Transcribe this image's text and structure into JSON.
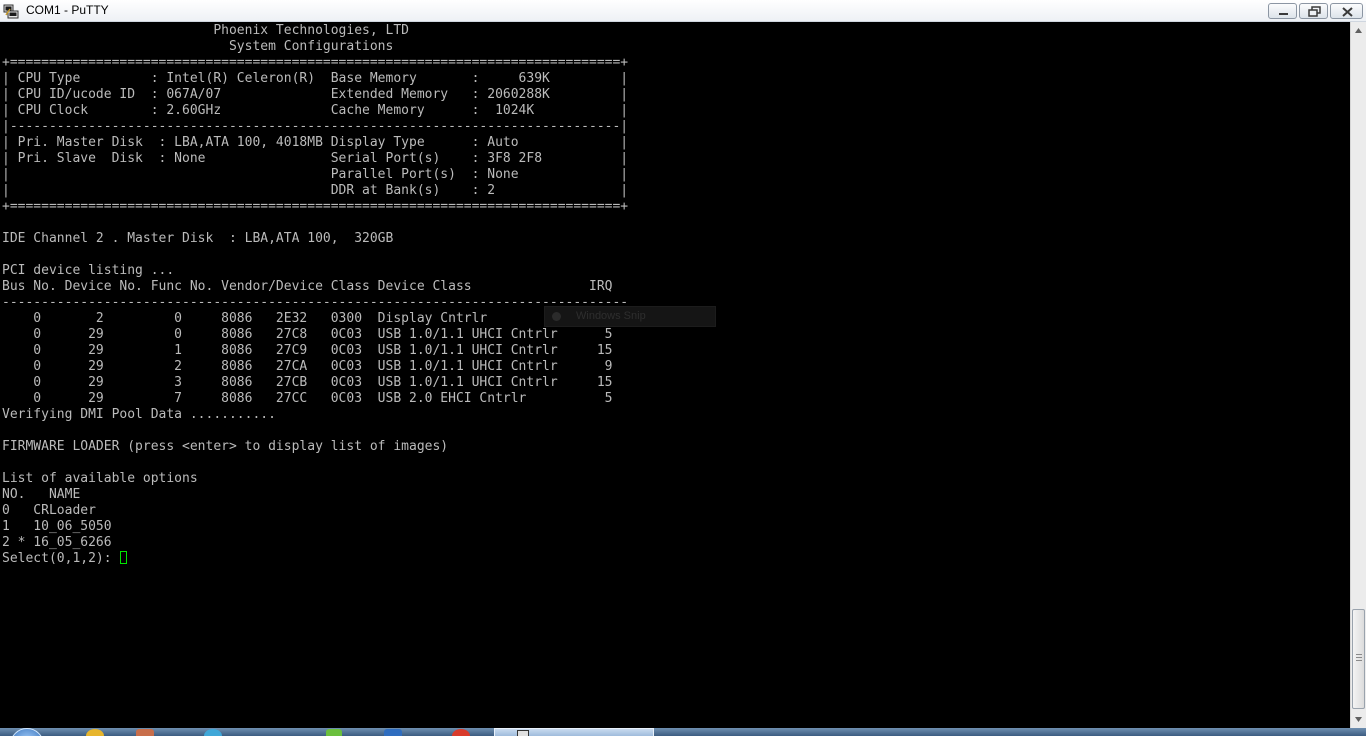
{
  "window": {
    "title": "COM1 - PuTTY",
    "app_icon": "putty-icon",
    "controls": {
      "minimize": "minimize-icon",
      "maximize": "maximize-icon",
      "close": "close-icon"
    }
  },
  "terminal": {
    "lines": [
      "                           Phoenix Technologies, LTD",
      "                             System Configurations",
      "+==============================================================================+",
      "| CPU Type         : Intel(R) Celeron(R)  Base Memory       :     639K         |",
      "| CPU ID/ucode ID  : 067A/07              Extended Memory   : 2060288K         |",
      "| CPU Clock        : 2.60GHz              Cache Memory      :  1024K           |",
      "|------------------------------------------------------------------------------|",
      "| Pri. Master Disk  : LBA,ATA 100, 4018MB Display Type      : Auto             |",
      "| Pri. Slave  Disk  : None                Serial Port(s)    : 3F8 2F8          |",
      "|                                         Parallel Port(s)  : None             |",
      "|                                         DDR at Bank(s)    : 2                |",
      "+==============================================================================+",
      "",
      "IDE Channel 2 . Master Disk  : LBA,ATA 100,  320GB",
      "",
      "PCI device listing ...",
      "Bus No. Device No. Func No. Vendor/Device Class Device Class               IRQ",
      "--------------------------------------------------------------------------------",
      "    0       2         0     8086   2E32   0300  Display Cntrlr              15",
      "    0      29         0     8086   27C8   0C03  USB 1.0/1.1 UHCI Cntrlr      5",
      "    0      29         1     8086   27C9   0C03  USB 1.0/1.1 UHCI Cntrlr     15",
      "    0      29         2     8086   27CA   0C03  USB 1.0/1.1 UHCI Cntrlr      9",
      "    0      29         3     8086   27CB   0C03  USB 1.0/1.1 UHCI Cntrlr     15",
      "    0      29         7     8086   27CC   0C03  USB 2.0 EHCI Cntrlr          5",
      "Verifying DMI Pool Data ...........",
      "",
      "FIRMWARE LOADER (press <enter> to display list of images)",
      "",
      "List of available options",
      "NO.   NAME",
      "0   CRLoader",
      "1   10_06_5050",
      "2 * 16_05_6266"
    ],
    "prompt": "Select(0,1,2): ",
    "overlay_label": "Windows Snip",
    "text_color": "#bbbbbb",
    "cursor_color": "#00e600"
  },
  "taskbar": {
    "start_icon": "windows-start-orb-icon"
  }
}
